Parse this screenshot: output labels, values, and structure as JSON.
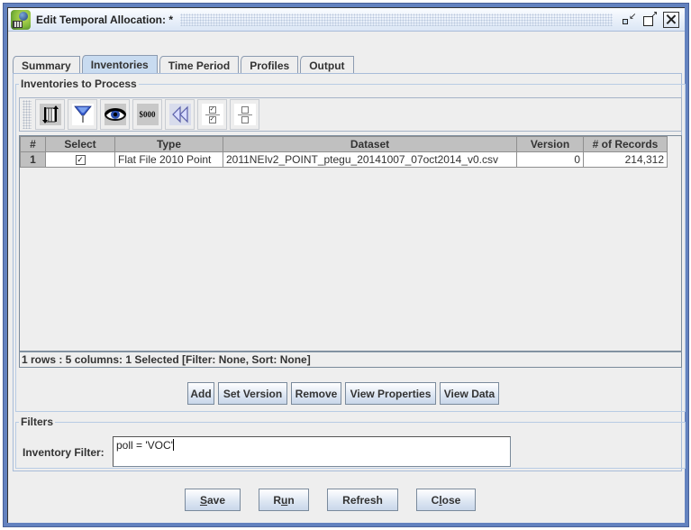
{
  "window": {
    "title": "Edit Temporal Allocation:  *",
    "controls": [
      "iconify-icon",
      "maximize-icon",
      "close-icon"
    ]
  },
  "tabs": [
    {
      "label": "Summary",
      "active": false
    },
    {
      "label": "Inventories",
      "active": true
    },
    {
      "label": "Time Period",
      "active": false
    },
    {
      "label": "Profiles",
      "active": false
    },
    {
      "label": "Output",
      "active": false
    }
  ],
  "inventories": {
    "group_title": "Inventories to Process",
    "toolbar": [
      {
        "name": "sort-icon",
        "tooltip": "Sort"
      },
      {
        "name": "filter-icon",
        "tooltip": "Filter"
      },
      {
        "name": "eye-icon",
        "tooltip": "Show/Hide Columns"
      },
      {
        "name": "format-money-icon",
        "label": "$000",
        "tooltip": "Format Columns"
      },
      {
        "name": "reset-icon",
        "tooltip": "Reset"
      },
      {
        "name": "select-all-icon",
        "tooltip": "Select All"
      },
      {
        "name": "clear-all-icon",
        "tooltip": "Clear All"
      }
    ],
    "table": {
      "columns": [
        "#",
        "Select",
        "Type",
        "Dataset",
        "Version",
        "# of Records"
      ],
      "rows": [
        {
          "num": "1",
          "selected": true,
          "type": "Flat File 2010 Point",
          "dataset": "2011NEIv2_POINT_ptegu_20141007_07oct2014_v0.csv",
          "version": "0",
          "records": "214,312"
        }
      ]
    },
    "status": "1 rows : 5 columns: 1 Selected [Filter: None, Sort: None]",
    "buttons": {
      "add": "Add",
      "set_version": "Set Version",
      "remove": "Remove",
      "view_properties": "View Properties",
      "view_data": "View Data"
    }
  },
  "filters": {
    "group_title": "Filters",
    "inventory_filter_label": "Inventory Filter:",
    "inventory_filter_value": "poll = 'VOC'"
  },
  "footer": {
    "save": {
      "pre": "",
      "mn": "S",
      "post": "ave"
    },
    "run": {
      "pre": "R",
      "mn": "u",
      "post": "n"
    },
    "refresh": {
      "pre": "Refresh",
      "mn": "",
      "post": ""
    },
    "close": {
      "pre": "C",
      "mn": "l",
      "post": "ose"
    }
  }
}
